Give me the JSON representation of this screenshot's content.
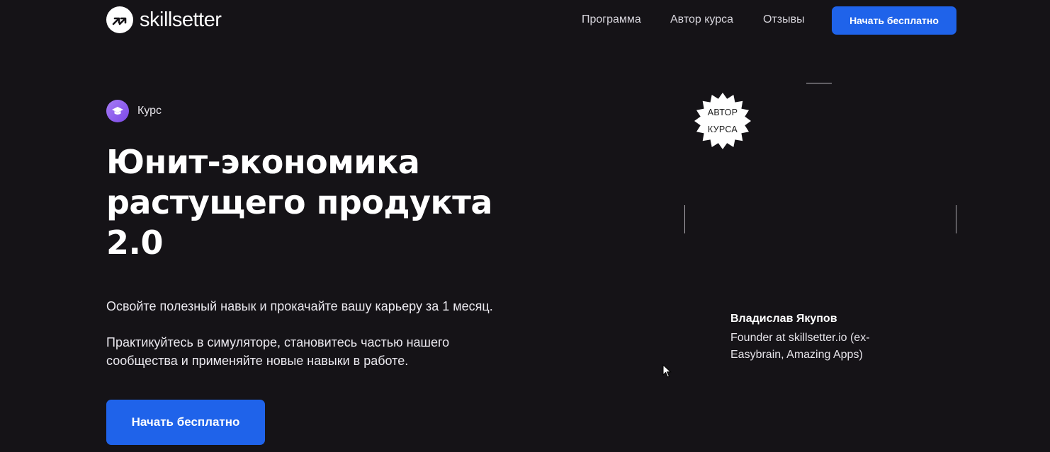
{
  "header": {
    "logo_text": "skillsetter",
    "nav": [
      {
        "label": "Программа"
      },
      {
        "label": "Автор курса"
      },
      {
        "label": "Отзывы"
      }
    ],
    "cta_label": "Начать бесплатно"
  },
  "hero": {
    "badge_label": "Курс",
    "title_lines": [
      "Юнит-экономика",
      "растущего продукта",
      "2.0"
    ],
    "description_1": "Освойте полезный навык и прокачайте вашу карьеру за 1 месяц.",
    "description_2": "Практикуйтесь в симуляторе, становитесь частью нашего сообщества и применяйте новые навыки в работе.",
    "cta_label": "Начать бесплатно"
  },
  "author": {
    "seal_line_1": "АВТОР",
    "seal_line_2": "КУРСА",
    "name": "Владислав Якупов",
    "role": "Founder at skillsetter.io (ex-Easybrain, Amazing Apps)"
  },
  "icons": {
    "logo": "logo-arrows-icon",
    "badge": "graduation-cap-icon",
    "seal": "badge-seal-icon",
    "cursor": "mouse-pointer-icon"
  },
  "colors": {
    "background": "#151317",
    "accent_blue": "#1f63ea",
    "badge_purple": "#8b5cf6",
    "text": "#ffffff"
  }
}
